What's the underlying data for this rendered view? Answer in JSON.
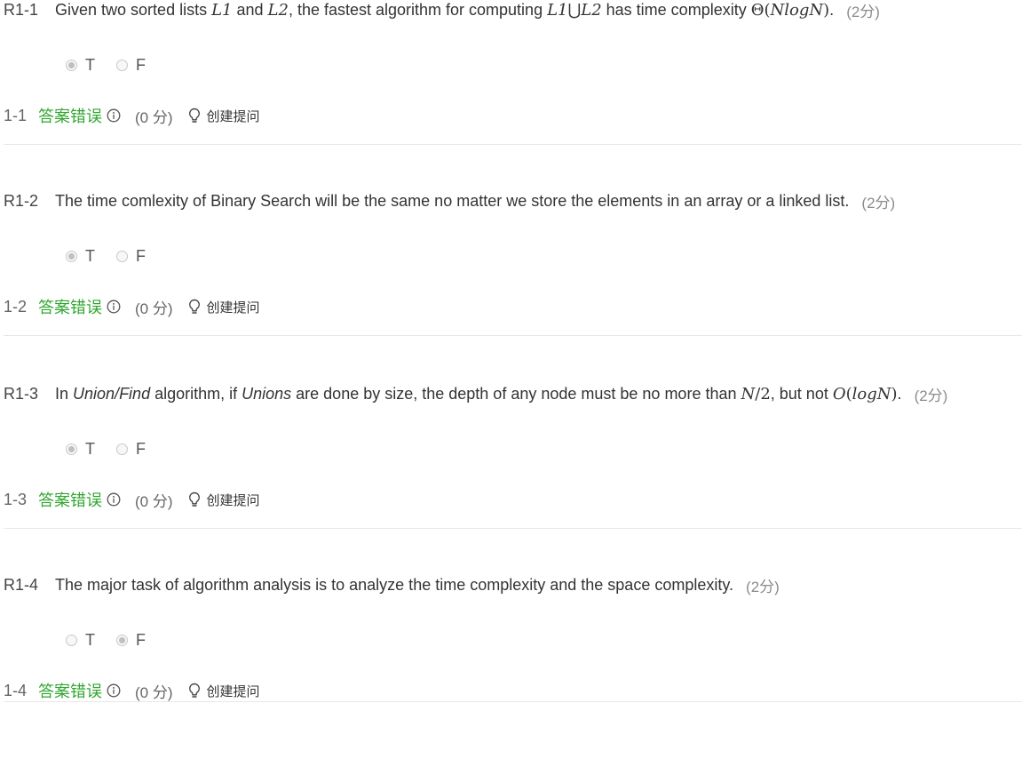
{
  "questions": [
    {
      "id": "R1-1",
      "text_parts": [
        {
          "t": "Given two sorted lists ",
          "s": "text"
        },
        {
          "t": "L1",
          "s": "math"
        },
        {
          "t": " and ",
          "s": "text"
        },
        {
          "t": "L2",
          "s": "math"
        },
        {
          "t": ", the fastest algorithm for computing ",
          "s": "text"
        },
        {
          "t": "L1",
          "s": "math"
        },
        {
          "t": "⋃",
          "s": "math-up"
        },
        {
          "t": "L2",
          "s": "math"
        },
        {
          "t": " has time complexity ",
          "s": "text"
        },
        {
          "t": "Θ",
          "s": "math-up"
        },
        {
          "t": "(",
          "s": "math-up"
        },
        {
          "t": "NlogN",
          "s": "math"
        },
        {
          "t": ")",
          "s": "math-up"
        },
        {
          "t": ".",
          "s": "text"
        }
      ],
      "score": "(2分)",
      "options": [
        {
          "label": "T",
          "checked": true
        },
        {
          "label": "F",
          "checked": false
        }
      ],
      "result_num": "1-1",
      "result_status": "答案错误",
      "result_score": "(0 分)",
      "ask_label": "创建提问"
    },
    {
      "id": "R1-2",
      "text_parts": [
        {
          "t": "The time comlexity of Binary Search will be the same no matter we store the elements in an array or a linked list.",
          "s": "text"
        }
      ],
      "score": "(2分)",
      "options": [
        {
          "label": "T",
          "checked": true
        },
        {
          "label": "F",
          "checked": false
        }
      ],
      "result_num": "1-2",
      "result_status": "答案错误",
      "result_score": "(0 分)",
      "ask_label": "创建提问"
    },
    {
      "id": "R1-3",
      "text_parts": [
        {
          "t": "In ",
          "s": "text"
        },
        {
          "t": "Union/Find",
          "s": "emph"
        },
        {
          "t": " algorithm, if ",
          "s": "text"
        },
        {
          "t": "Unions",
          "s": "emph"
        },
        {
          "t": " are done by size, the depth of any node must be no more than ",
          "s": "text"
        },
        {
          "t": "N",
          "s": "math"
        },
        {
          "t": "/2",
          "s": "math-up"
        },
        {
          "t": ", but not ",
          "s": "text"
        },
        {
          "t": "O",
          "s": "math"
        },
        {
          "t": "(",
          "s": "math-up"
        },
        {
          "t": "logN",
          "s": "math"
        },
        {
          "t": ")",
          "s": "math-up"
        },
        {
          "t": ".",
          "s": "text"
        }
      ],
      "score": "(2分)",
      "options": [
        {
          "label": "T",
          "checked": true
        },
        {
          "label": "F",
          "checked": false
        }
      ],
      "result_num": "1-3",
      "result_status": "答案错误",
      "result_score": "(0 分)",
      "ask_label": "创建提问"
    },
    {
      "id": "R1-4",
      "text_parts": [
        {
          "t": "The major task of algorithm analysis is to analyze the time complexity and the space complexity.",
          "s": "text"
        }
      ],
      "score": "(2分)",
      "options": [
        {
          "label": "T",
          "checked": false
        },
        {
          "label": "F",
          "checked": true
        }
      ],
      "result_num": "1-4",
      "result_status": "答案错误",
      "result_score": "(0 分)",
      "ask_label": "创建提问"
    }
  ],
  "icons": {
    "info": "info-circle-icon",
    "ask": "lightbulb-icon"
  },
  "colors": {
    "status_wrong": "#32a632",
    "score_gray": "#8c8c8c",
    "divider": "#e8e8e8"
  }
}
